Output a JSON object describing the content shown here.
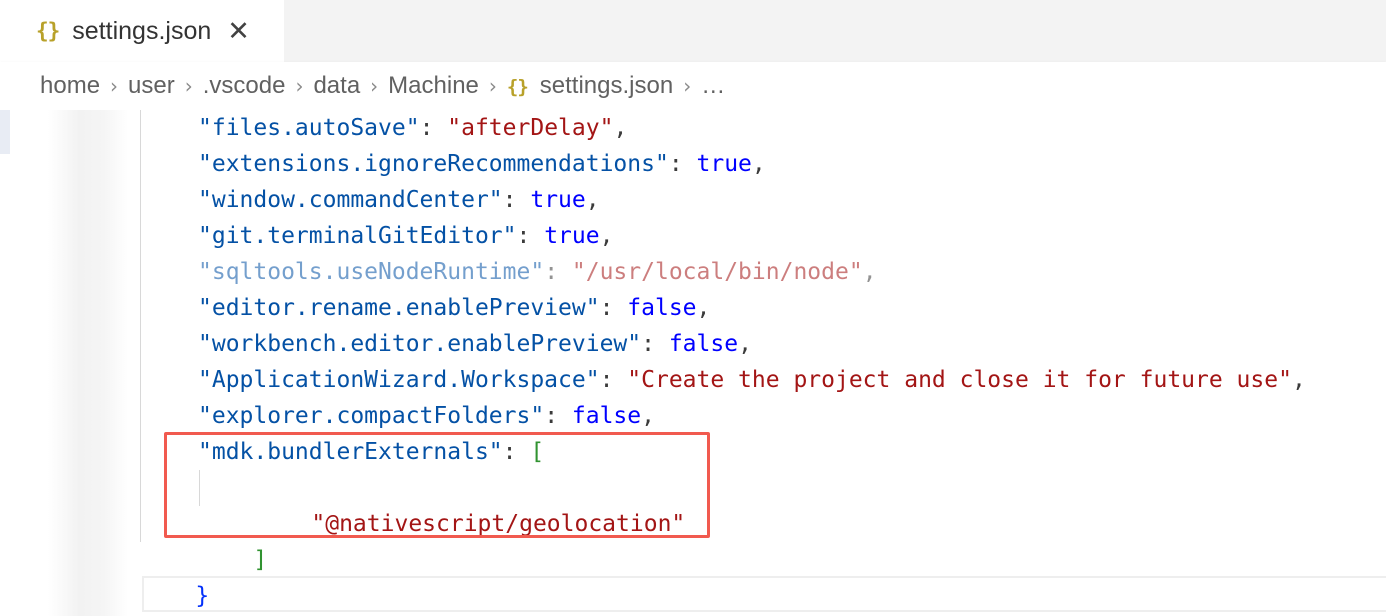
{
  "tab": {
    "icon": "{}",
    "label": "settings.json",
    "close": "✕"
  },
  "breadcrumb": {
    "items": [
      "home",
      "user",
      ".vscode",
      "data",
      "Machine"
    ],
    "file_icon": "{}",
    "file": "settings.json",
    "more": "…",
    "separator": "›"
  },
  "code": {
    "lines": [
      {
        "key": "\"files.autoSave\"",
        "value": "\"afterDelay\"",
        "value_type": "string",
        "suffix": ","
      },
      {
        "key": "\"extensions.ignoreRecommendations\"",
        "value": "true",
        "value_type": "bool",
        "suffix": ","
      },
      {
        "key": "\"window.commandCenter\"",
        "value": "true",
        "value_type": "bool",
        "suffix": ","
      },
      {
        "key": "\"git.terminalGitEditor\"",
        "value": "true",
        "value_type": "bool",
        "suffix": ","
      },
      {
        "key": "\"sqltools.useNodeRuntime\"",
        "value": "\"/usr/local/bin/node\"",
        "value_type": "string",
        "suffix": ","
      },
      {
        "key": "\"editor.rename.enablePreview\"",
        "value": "false",
        "value_type": "bool",
        "suffix": ","
      },
      {
        "key": "\"workbench.editor.enablePreview\"",
        "value": "false",
        "value_type": "bool",
        "suffix": ","
      },
      {
        "key": "\"ApplicationWizard.Workspace\"",
        "value": "\"Create the project and close it for future use\"",
        "value_type": "string",
        "suffix": ","
      },
      {
        "key": "\"explorer.compactFolders\"",
        "value": "false",
        "value_type": "bool",
        "suffix": ","
      },
      {
        "key": "\"mdk.bundlerExternals\"",
        "value": "[",
        "value_type": "bracket",
        "suffix": ""
      }
    ],
    "array_item": "\"@nativescript/geolocation\"",
    "array_close": "]",
    "object_close": "}",
    "colon": ": "
  },
  "colors": {
    "key": "#0451a5",
    "string": "#a31515",
    "bool": "#0000ff",
    "bracket": "#319331",
    "highlight_border": "#f15a4f",
    "json_icon": "#b8a12a"
  }
}
